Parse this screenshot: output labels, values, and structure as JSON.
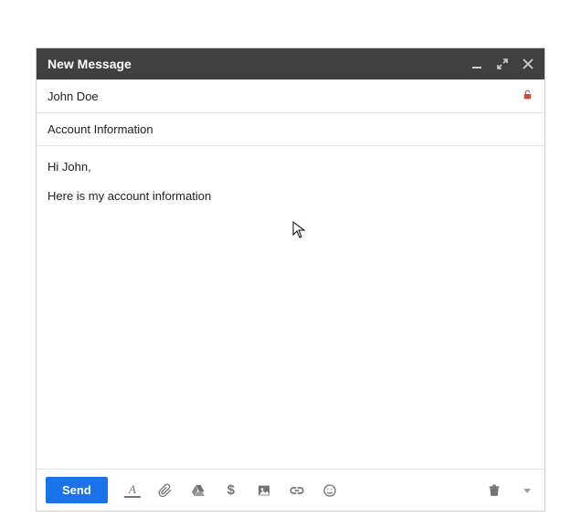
{
  "titlebar": {
    "title": "New Message"
  },
  "recipient": {
    "value": "John Doe"
  },
  "subject": {
    "value": "Account Information"
  },
  "body": {
    "line1": "Hi John,",
    "line2": "Here is my account information"
  },
  "toolbar": {
    "send_label": "Send"
  }
}
